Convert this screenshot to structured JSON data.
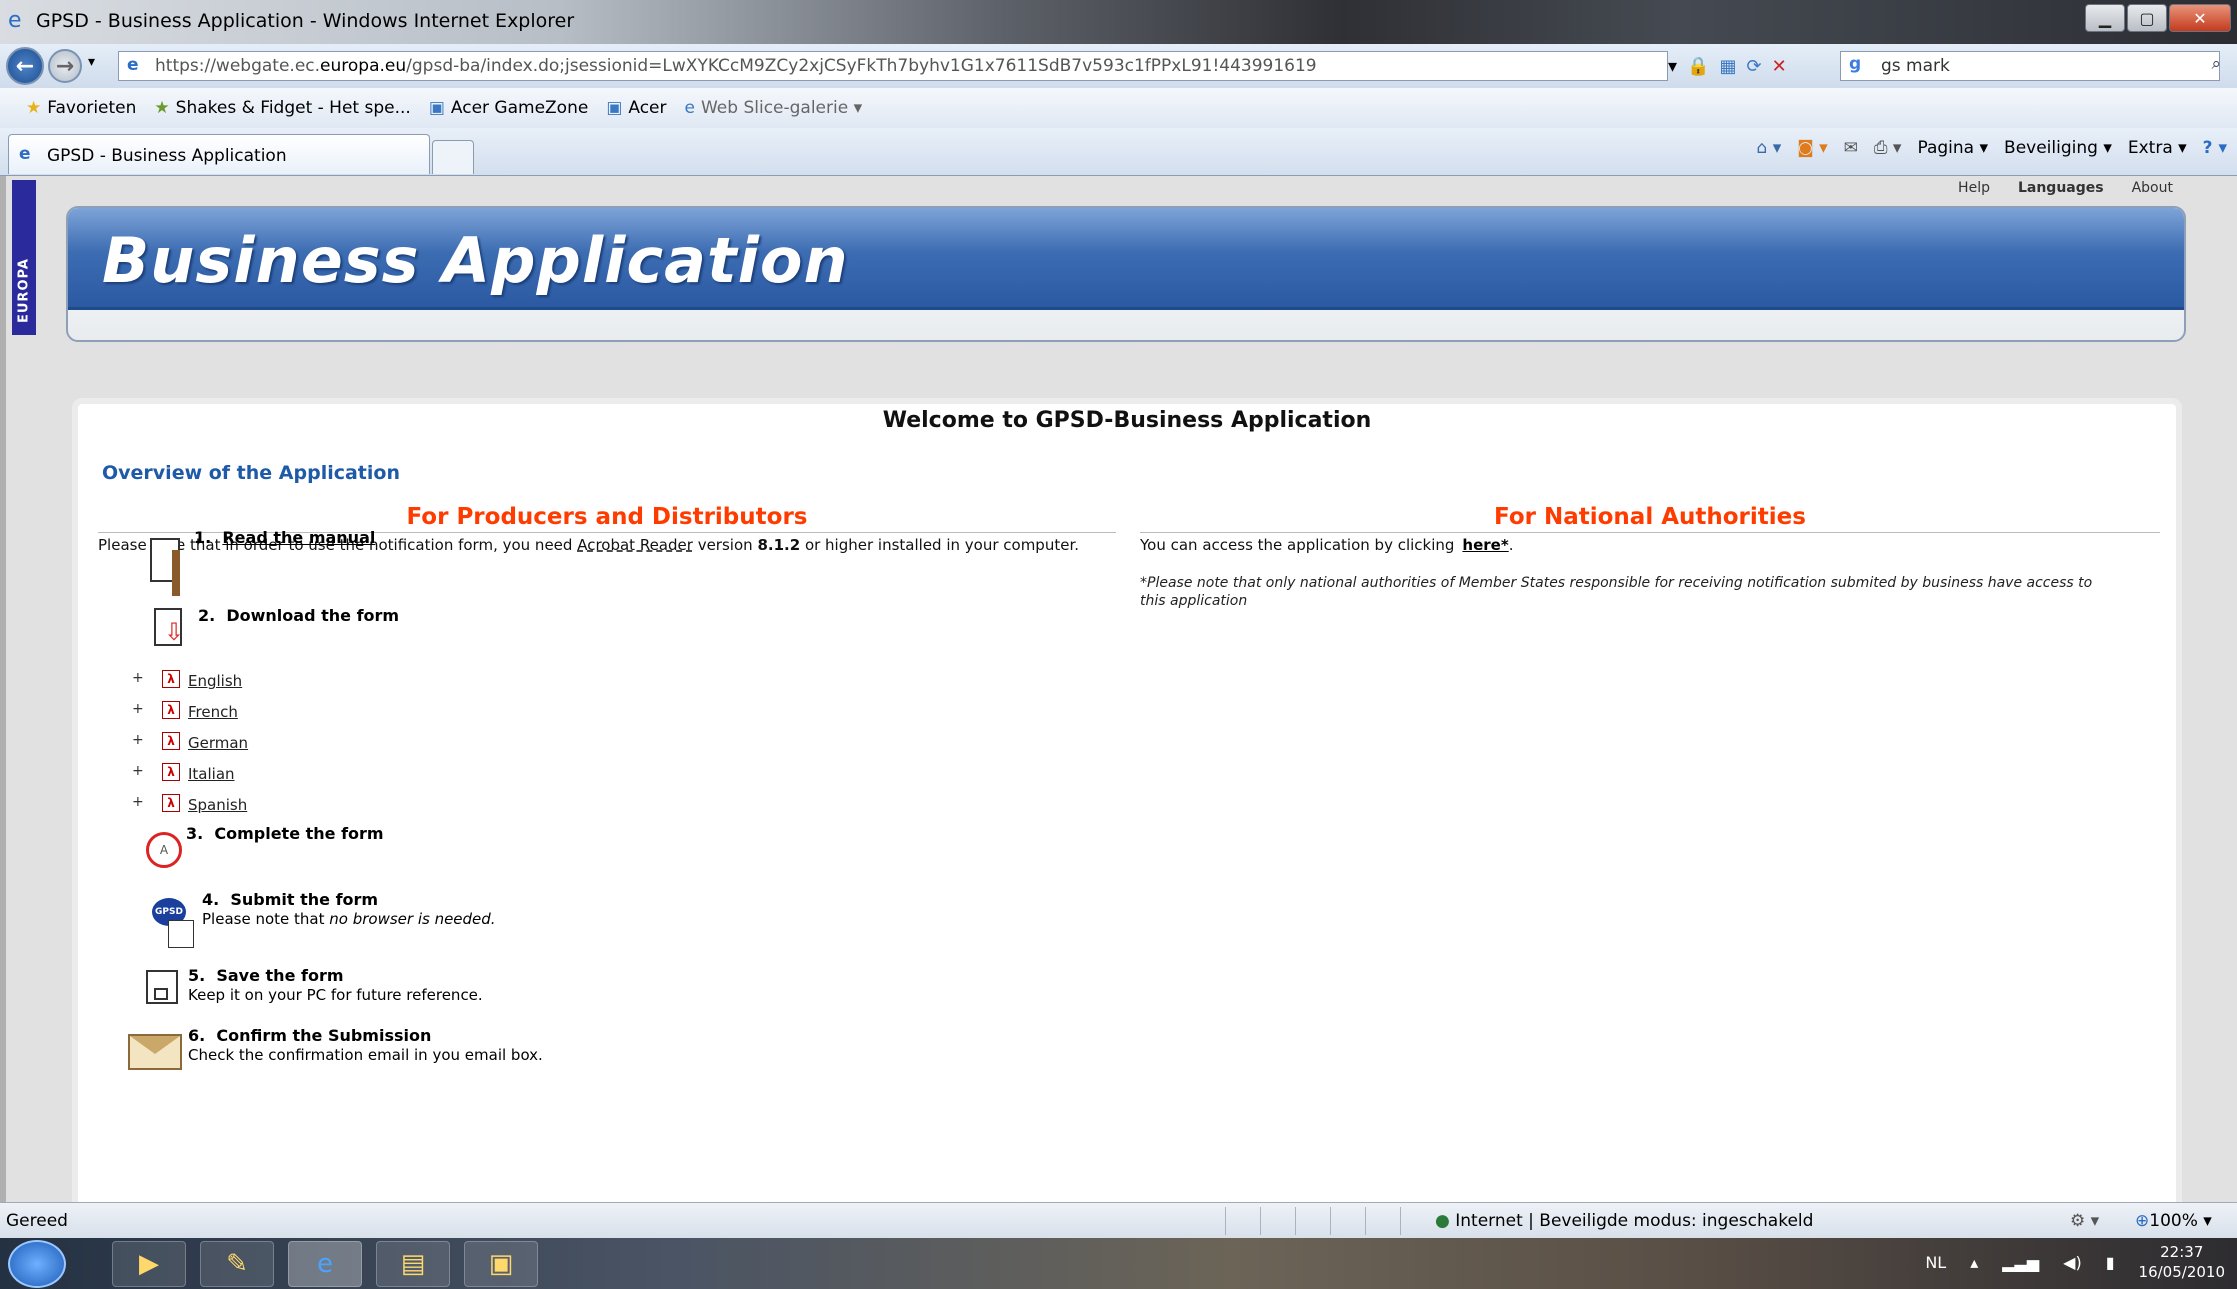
{
  "window": {
    "title": "GPSD - Business Application - Windows Internet Explorer"
  },
  "address_bar": {
    "url_prefix": "https://webgate.ec.",
    "url_domain": "europa.eu",
    "url_rest": "/gpsd-ba/index.do;jsessionid=LwXYKCcM9ZCy2xjCSyFkTh7byhv1G1x7611SdB7v593c1fPPxL91!443991619",
    "search_value": "gs mark"
  },
  "favorites_bar": {
    "favorites_label": "Favorieten",
    "items": [
      "Shakes & Fidget - Het spe...",
      "Acer GameZone",
      "Acer",
      "Web Slice-galerie"
    ]
  },
  "tab": {
    "label": "GPSD - Business Application"
  },
  "command_bar": {
    "page": "Pagina",
    "security": "Beveiliging",
    "extra": "Extra"
  },
  "page": {
    "europa_label": "EUROPA",
    "top_links": {
      "help": "Help",
      "languages": "Languages",
      "about": "About"
    },
    "banner_title": "Business Application",
    "welcome": "Welcome to GPSD-Business Application",
    "overview": "Overview of the Application",
    "left": {
      "heading": "For Producers and Distributors",
      "note_pre": "Please note that in order to use the notification form, you need",
      "note_reader": "Acrobat Reader",
      "note_mid": "version",
      "note_version": "8.1.2",
      "note_post": "or higher installed in your computer.",
      "step1_num": "1.",
      "step1": "Read the manual",
      "step2_num": "2.",
      "step2": "Download the form",
      "languages": [
        "English",
        "French",
        "German",
        "Italian",
        "Spanish"
      ],
      "step3_num": "3.",
      "step3": "Complete the form",
      "step4_num": "4.",
      "step4": "Submit the form",
      "step4_sub_pre": "Please note that",
      "step4_sub_em": "no browser is needed.",
      "step5_num": "5.",
      "step5": "Save the form",
      "step5_sub": "Keep it on your PC for future reference.",
      "step6_num": "6.",
      "step6": "Confirm the Submission",
      "step6_sub": "Check the confirmation email in you email box."
    },
    "right": {
      "heading": "For National Authorities",
      "note": "You can access the application by clicking",
      "link": "here*",
      "link_suffix": ".",
      "disclaimer": "*Please note that only national authorities of Member States responsible for receiving notification submited by business have access to this application"
    }
  },
  "status_bar": {
    "status": "Gereed",
    "zone": "Internet | Beveiligde modus: ingeschakeld",
    "zoom": "100%"
  },
  "taskbar": {
    "lang": "NL",
    "time": "22:37",
    "date": "16/05/2010"
  }
}
